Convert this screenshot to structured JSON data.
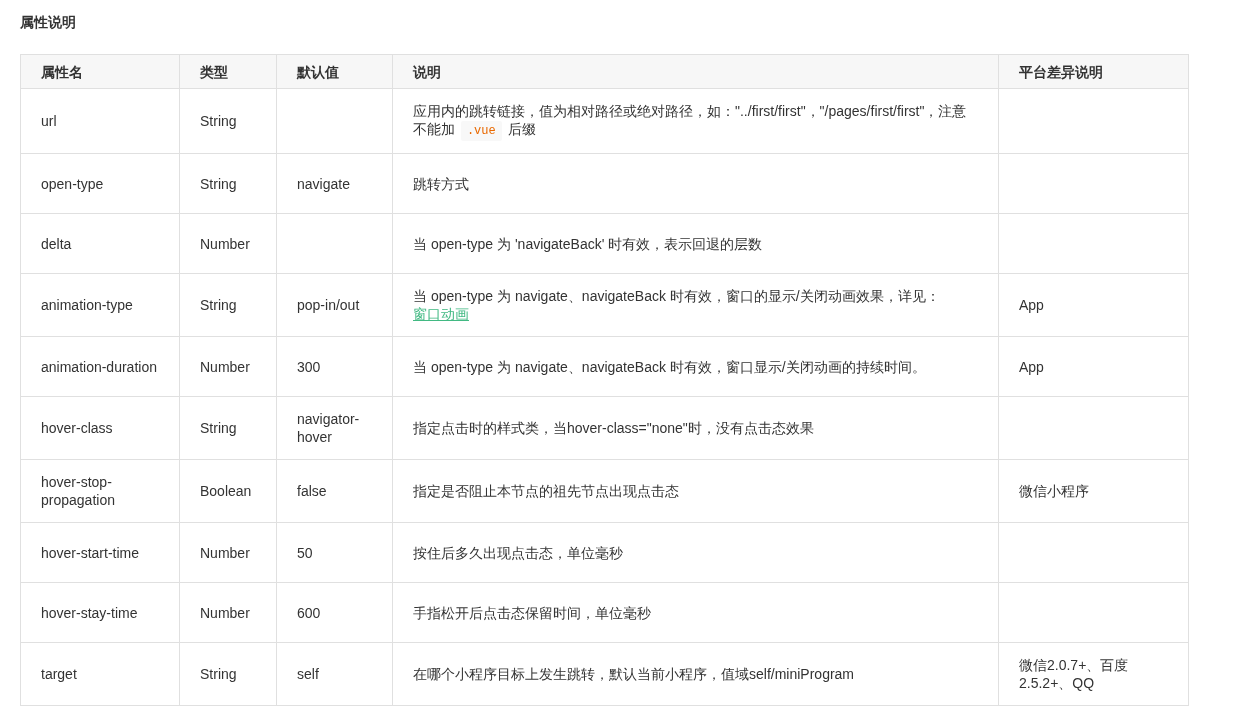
{
  "section_title": "属性说明",
  "table": {
    "columns": [
      "属性名",
      "类型",
      "默认值",
      "说明",
      "平台差异说明"
    ],
    "rows": [
      {
        "name": "url",
        "type": "String",
        "default": "",
        "description": [
          {
            "kind": "text",
            "text": "应用内的跳转链接，值为相对路径或绝对路径，如：\"../first/first\"，\"/pages/first/first\"，注意不能加 "
          },
          {
            "kind": "code",
            "text": ".vue"
          },
          {
            "kind": "text",
            "text": " 后缀"
          }
        ],
        "platform": ""
      },
      {
        "name": "open-type",
        "type": "String",
        "default": "navigate",
        "description": [
          {
            "kind": "text",
            "text": "跳转方式"
          }
        ],
        "platform": ""
      },
      {
        "name": "delta",
        "type": "Number",
        "default": "",
        "description": [
          {
            "kind": "text",
            "text": "当 open-type 为 'navigateBack' 时有效，表示回退的层数"
          }
        ],
        "platform": ""
      },
      {
        "name": "animation-type",
        "type": "String",
        "default": "pop-in/out",
        "description": [
          {
            "kind": "text",
            "text": "当 open-type 为 navigate、navigateBack 时有效，窗口的显示/关闭动画效果，详见："
          },
          {
            "kind": "link",
            "text": "窗口动画"
          }
        ],
        "platform": "App"
      },
      {
        "name": "animation-duration",
        "type": "Number",
        "default": "300",
        "description": [
          {
            "kind": "text",
            "text": "当 open-type 为 navigate、navigateBack 时有效，窗口显示/关闭动画的持续时间。"
          }
        ],
        "platform": "App"
      },
      {
        "name": "hover-class",
        "type": "String",
        "default": "navigator-hover",
        "description": [
          {
            "kind": "text",
            "text": "指定点击时的样式类，当hover-class=\"none\"时，没有点击态效果"
          }
        ],
        "platform": ""
      },
      {
        "name": "hover-stop-propagation",
        "type": "Boolean",
        "default": "false",
        "description": [
          {
            "kind": "text",
            "text": "指定是否阻止本节点的祖先节点出现点击态"
          }
        ],
        "platform": "微信小程序"
      },
      {
        "name": "hover-start-time",
        "type": "Number",
        "default": "50",
        "description": [
          {
            "kind": "text",
            "text": "按住后多久出现点击态，单位毫秒"
          }
        ],
        "platform": ""
      },
      {
        "name": "hover-stay-time",
        "type": "Number",
        "default": "600",
        "description": [
          {
            "kind": "text",
            "text": "手指松开后点击态保留时间，单位毫秒"
          }
        ],
        "platform": ""
      },
      {
        "name": "target",
        "type": "String",
        "default": "self",
        "description": [
          {
            "kind": "text",
            "text": "在哪个小程序目标上发生跳转，默认当前小程序，值域self/miniProgram"
          }
        ],
        "platform": "微信2.0.7+、百度2.5.2+、QQ"
      }
    ]
  }
}
